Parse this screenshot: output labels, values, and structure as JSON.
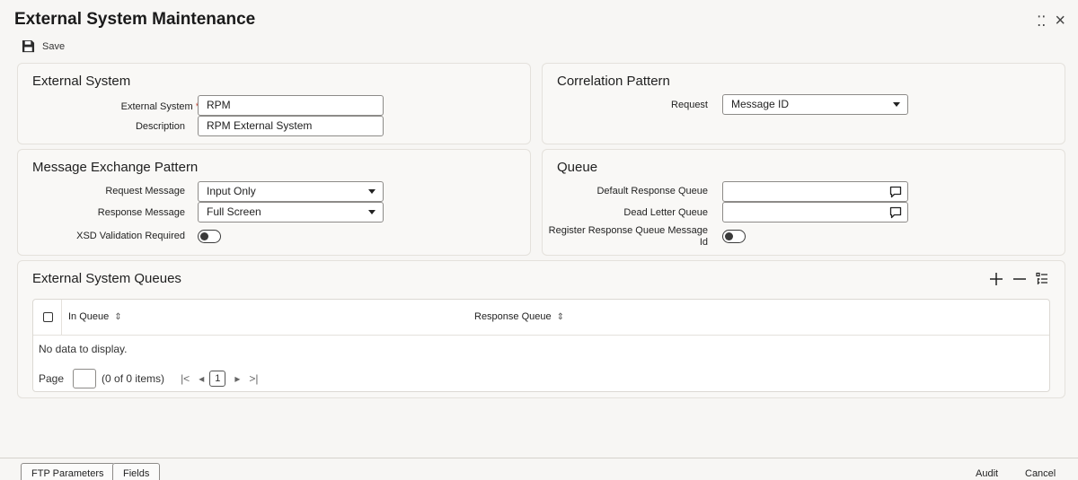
{
  "window": {
    "title": "External System Maintenance",
    "minimize_glyph": "⁚⁚",
    "close_glyph": "×"
  },
  "toolbar": {
    "save_label": "Save",
    "save_icon": "floppy-disk-icon"
  },
  "external_system": {
    "heading": "External System",
    "external_system_label": "External System",
    "required_mark": "*",
    "external_system_value": "RPM",
    "description_label": "Description",
    "description_value": "RPM External System"
  },
  "correlation_pattern": {
    "heading": "Correlation Pattern",
    "request_label": "Request",
    "request_value": "Message ID"
  },
  "message_exchange": {
    "heading": "Message Exchange Pattern",
    "request_message_label": "Request Message",
    "request_message_value": "Input Only",
    "response_message_label": "Response Message",
    "response_message_value": "Full Screen",
    "xsd_label": "XSD Validation Required",
    "xsd_enabled": false
  },
  "queue": {
    "heading": "Queue",
    "default_response_label": "Default Response Queue",
    "default_response_value": "",
    "dead_letter_label": "Dead Letter Queue",
    "dead_letter_value": "",
    "register_label_line1": "Register Response Queue Message",
    "register_label_line2": "Id",
    "register_enabled": false
  },
  "queues_grid": {
    "heading": "External System Queues",
    "columns": [
      "In Queue",
      "Response Queue"
    ],
    "rows": [],
    "empty_text": "No data to display.",
    "page_label": "Page",
    "items_text": "(0 of 0 items)",
    "current_page": "1",
    "nav_first": "|<",
    "nav_prev": "◂",
    "nav_next": "▸",
    "nav_last": ">|"
  },
  "footer": {
    "tabs": [
      "FTP Parameters",
      "Fields"
    ],
    "audit_label": "Audit",
    "cancel_label": "Cancel"
  },
  "colors": {
    "required": "#c74634",
    "panel_bg": "#f9f8f6",
    "border": "#8d8b88"
  }
}
